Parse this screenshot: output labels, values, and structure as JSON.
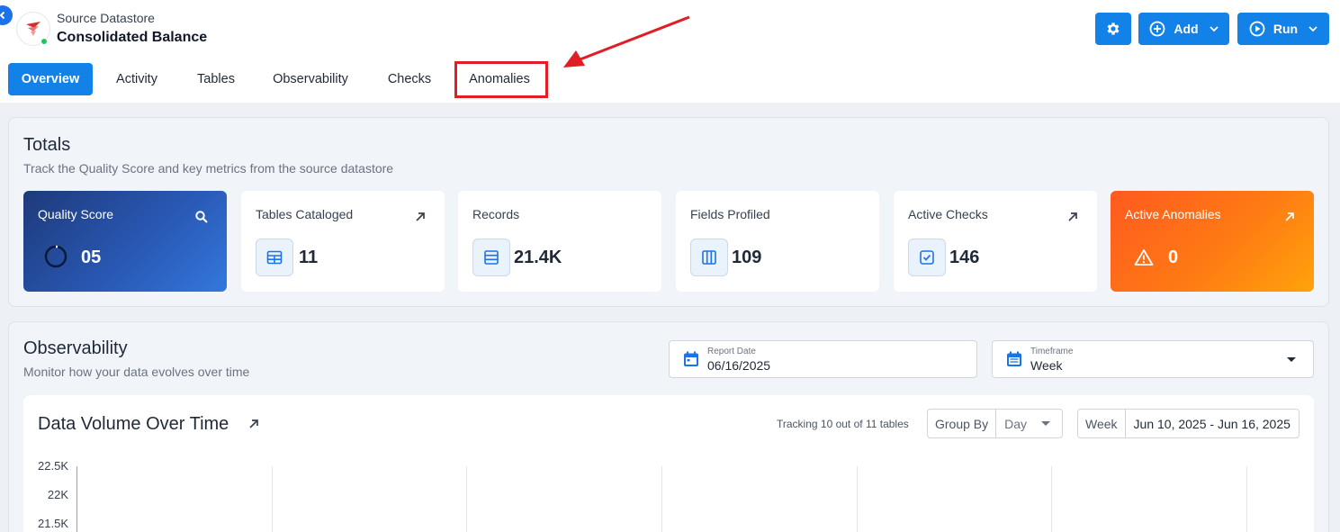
{
  "header": {
    "datastore_type": "Source Datastore",
    "datastore_name": "Consolidated Balance",
    "add_label": "Add",
    "run_label": "Run",
    "icons": {
      "back": "chevron-left-icon",
      "settings": "gear-icon",
      "add": "plus-circle-icon",
      "run": "play-circle-icon",
      "dropdown": "chevron-down-icon"
    },
    "accent_color": "#1282e8",
    "status_color": "#22c55e"
  },
  "tabs": [
    {
      "label": "Overview",
      "active": true
    },
    {
      "label": "Activity",
      "active": false
    },
    {
      "label": "Tables",
      "active": false
    },
    {
      "label": "Observability",
      "active": false
    },
    {
      "label": "Checks",
      "active": false
    },
    {
      "label": "Anomalies",
      "active": false,
      "highlighted": true
    }
  ],
  "annotation": {
    "highlight_color": "#e11d25",
    "target_tab": "Anomalies"
  },
  "totals": {
    "title": "Totals",
    "subtitle": "Track the Quality Score and key metrics from the source datastore",
    "cards": [
      {
        "label": "Quality Score",
        "value": "05",
        "icon": "search-icon"
      },
      {
        "label": "Tables Cataloged",
        "value": "11",
        "icon": "table-icon"
      },
      {
        "label": "Records",
        "value": "21.4K",
        "icon": "records-icon"
      },
      {
        "label": "Fields Profiled",
        "value": "109",
        "icon": "columns-icon"
      },
      {
        "label": "Active Checks",
        "value": "146",
        "icon": "check-square-icon"
      },
      {
        "label": "Active Anomalies",
        "value": "0",
        "icon": "warning-icon"
      }
    ]
  },
  "observability": {
    "title": "Observability",
    "subtitle": "Monitor how your data evolves over time",
    "report_date_label": "Report Date",
    "report_date_value": "06/16/2025",
    "timeframe_label": "Timeframe",
    "timeframe_value": "Week"
  },
  "data_volume": {
    "title": "Data Volume Over Time",
    "tracking": "Tracking 10 out of 11 tables",
    "group_by_label": "Group By",
    "group_by_value": "Day",
    "week_label": "Week",
    "week_range": "Jun 10, 2025 - Jun 16, 2025",
    "y_ticks": [
      "22.5K",
      "22K",
      "21.5K"
    ]
  }
}
